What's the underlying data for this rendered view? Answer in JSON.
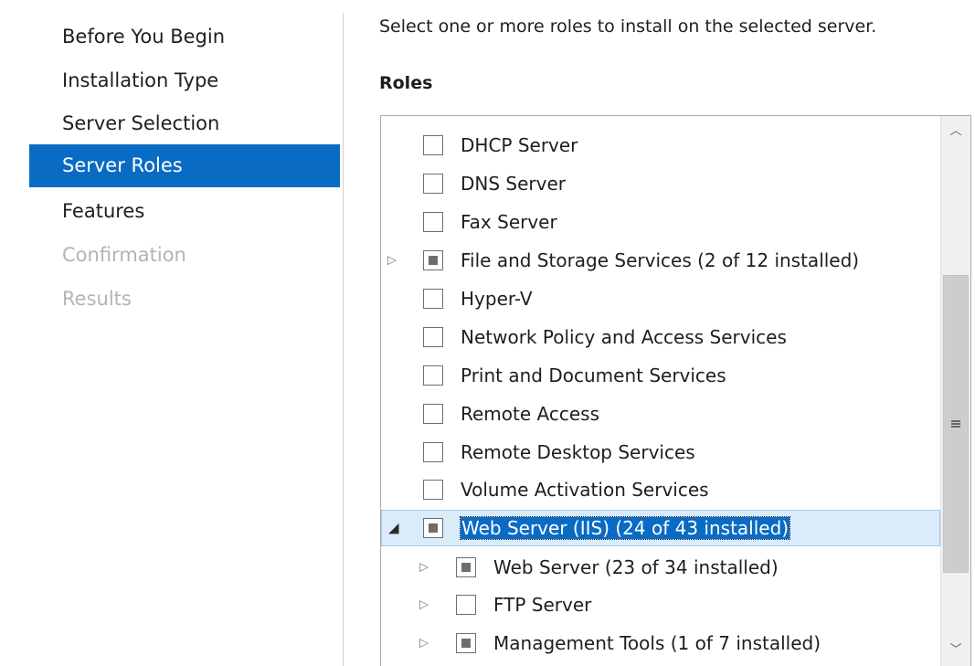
{
  "nav": {
    "items": [
      {
        "label": "Before You Begin",
        "state": "normal"
      },
      {
        "label": "Installation Type",
        "state": "normal"
      },
      {
        "label": "Server Selection",
        "state": "normal"
      },
      {
        "label": "Server Roles",
        "state": "active"
      },
      {
        "label": "Features",
        "state": "normal"
      },
      {
        "label": "Confirmation",
        "state": "disabled"
      },
      {
        "label": "Results",
        "state": "disabled"
      }
    ]
  },
  "content": {
    "intro": "Select one or more roles to install on the selected server.",
    "roles_label": "Roles"
  },
  "roles": [
    {
      "label": "DHCP Server",
      "checkbox": "unchecked",
      "expander": "none"
    },
    {
      "label": "DNS Server",
      "checkbox": "unchecked",
      "expander": "none"
    },
    {
      "label": "Fax Server",
      "checkbox": "unchecked",
      "expander": "none"
    },
    {
      "label": "File and Storage Services (2 of 12 installed)",
      "checkbox": "partial",
      "expander": "collapsed"
    },
    {
      "label": "Hyper-V",
      "checkbox": "unchecked",
      "expander": "none"
    },
    {
      "label": "Network Policy and Access Services",
      "checkbox": "unchecked",
      "expander": "none"
    },
    {
      "label": "Print and Document Services",
      "checkbox": "unchecked",
      "expander": "none"
    },
    {
      "label": "Remote Access",
      "checkbox": "unchecked",
      "expander": "none"
    },
    {
      "label": "Remote Desktop Services",
      "checkbox": "unchecked",
      "expander": "none"
    },
    {
      "label": "Volume Activation Services",
      "checkbox": "unchecked",
      "expander": "none"
    },
    {
      "label": "Web Server (IIS) (24 of 43 installed)",
      "checkbox": "partial",
      "expander": "expanded",
      "selected": true
    },
    {
      "label": "Web Server (23 of 34 installed)",
      "checkbox": "partial",
      "expander": "collapsed",
      "child": true
    },
    {
      "label": "FTP Server",
      "checkbox": "unchecked",
      "expander": "collapsed",
      "child": true
    },
    {
      "label": "Management Tools (1 of 7 installed)",
      "checkbox": "partial",
      "expander": "collapsed",
      "child": true
    }
  ],
  "icons": {
    "collapsed_expander": "▷",
    "expanded_expander": "◢",
    "scroll_up": "︿",
    "scroll_down": "﹀"
  },
  "colors": {
    "accent": "#0a6bc5",
    "selection_bg": "#daecfb",
    "disabled_text": "#b4b4b4"
  }
}
